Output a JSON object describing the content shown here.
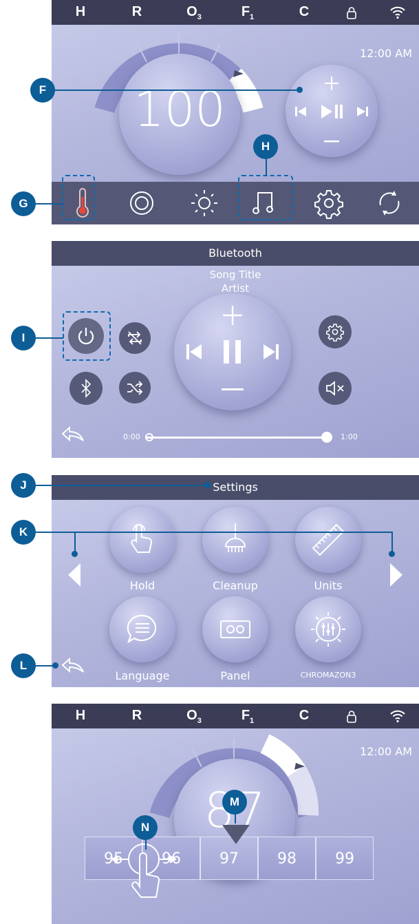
{
  "callouts": {
    "F": "F",
    "G": "G",
    "H": "H",
    "I": "I",
    "J": "J",
    "K": "K",
    "L": "L",
    "M": "M",
    "N": "N"
  },
  "status_indicators": [
    {
      "label": "H",
      "sub": ""
    },
    {
      "label": "R",
      "sub": ""
    },
    {
      "label": "O",
      "sub": "3"
    },
    {
      "label": "F",
      "sub": "1"
    },
    {
      "label": "C",
      "sub": ""
    }
  ],
  "status_icons": [
    "lock-icon",
    "wifi-icon"
  ],
  "main_screen": {
    "time": "12:00 AM",
    "temperature": "100"
  },
  "media_controls": [
    "plus-icon",
    "previous-icon",
    "play-pause-icon",
    "next-icon",
    "minus-icon"
  ],
  "nav_icons": [
    "thermometer-icon",
    "pump-icon",
    "light-icon",
    "music-icon",
    "settings-icon",
    "flip-icon"
  ],
  "bluetooth": {
    "title": "Bluetooth",
    "song_title": "Song Title",
    "artist": "Artist",
    "time_start": "0:00",
    "time_end": "1:00",
    "progress": 1.0
  },
  "settings": {
    "title": "Settings",
    "items": [
      {
        "label": "Hold",
        "icon": "hand-touch-icon"
      },
      {
        "label": "Cleanup",
        "icon": "brush-icon"
      },
      {
        "label": "Units",
        "icon": "ruler-icon"
      },
      {
        "label": "Language",
        "icon": "chat-icon"
      },
      {
        "label": "Panel",
        "icon": "panel-icon"
      },
      {
        "label": "CHROMAZON3",
        "icon": "chromazone-icon"
      }
    ]
  },
  "temp_screen": {
    "time": "12:00 AM",
    "temperature": "87",
    "scroll_values": [
      "95",
      "96",
      "97",
      "98",
      "99"
    ]
  },
  "colors": {
    "callout": "#0d5d97",
    "statusbar": "#3a3d55",
    "panel": "#b3b6dc",
    "accent_red": "#e8473c"
  }
}
